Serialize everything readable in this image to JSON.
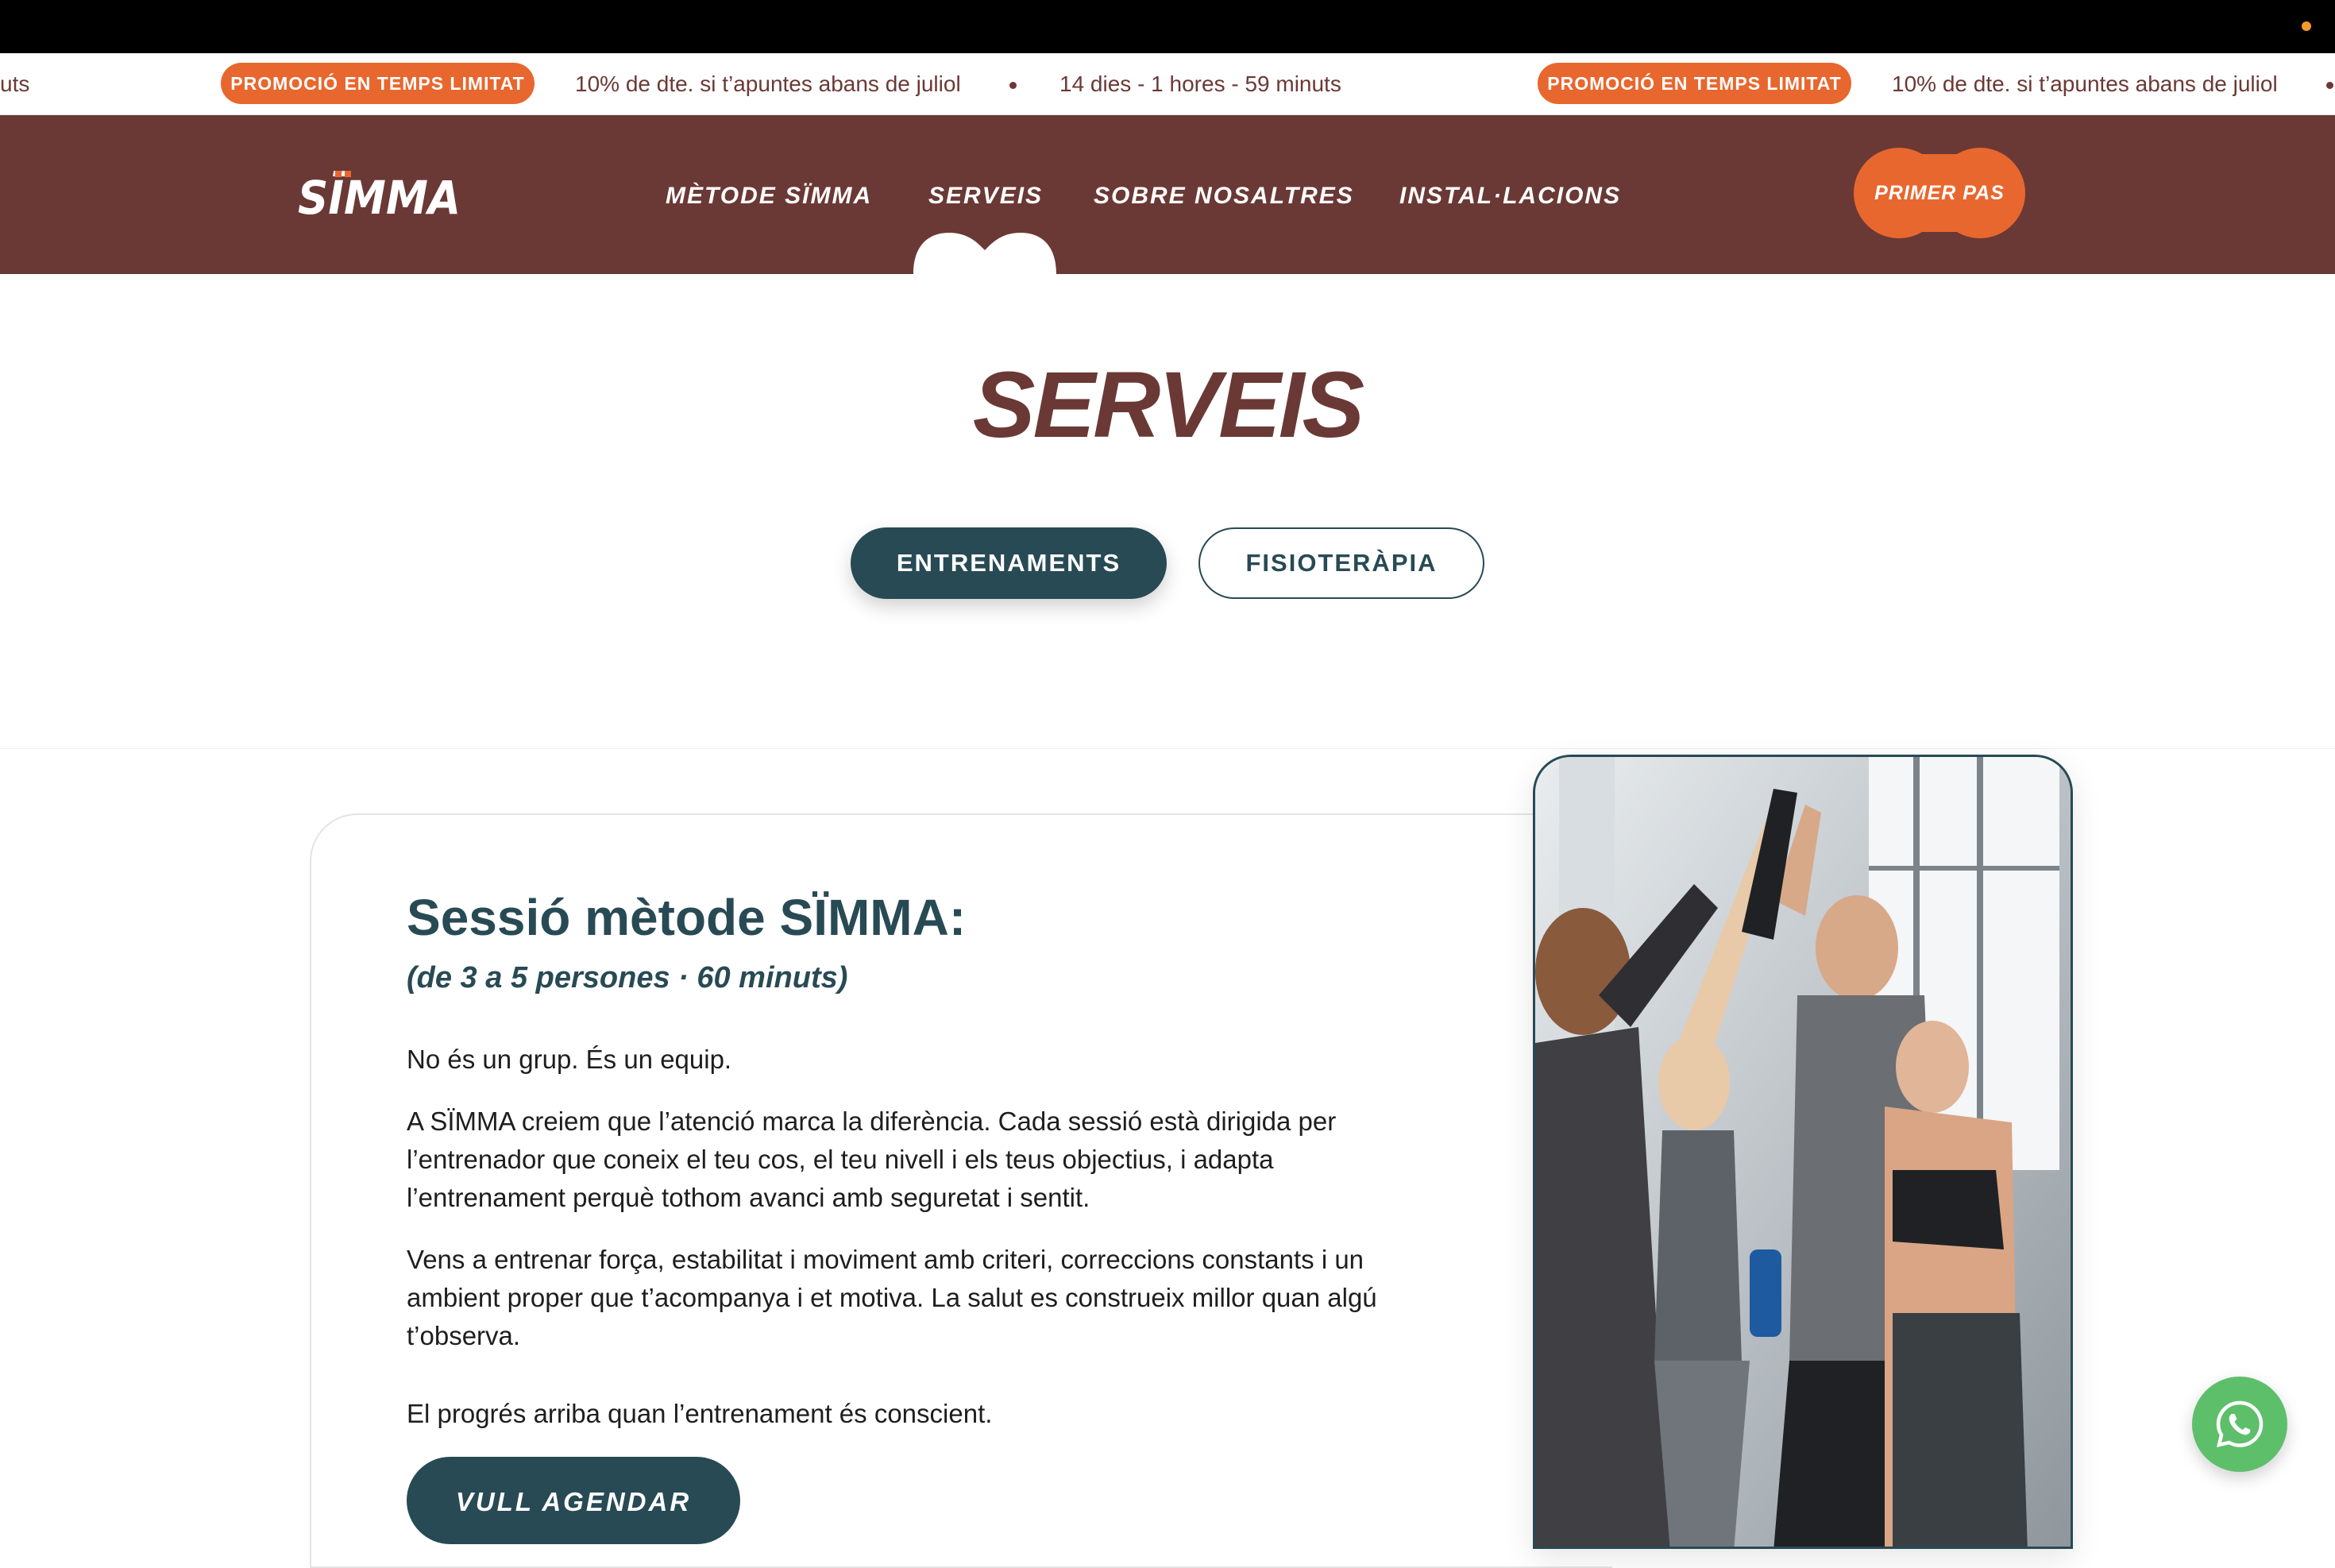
{
  "ticker": {
    "fragment_left": "uts",
    "badge": "PROMOCIÓ EN TEMPS LIMITAT",
    "offer": "10% de dte. si t’apuntes abans de juliol",
    "countdown": "14 dies - 1 hores - 59 minuts"
  },
  "header": {
    "logo_text": "SÏMMA",
    "nav": [
      "MÈTODE SÏMMA",
      "SERVEIS",
      "SOBRE NOSALTRES",
      "INSTAL·LACIONS"
    ],
    "active_nav": "SERVEIS",
    "cta_label": "PRIMER PAS",
    "colors": {
      "brand": "#6b3935",
      "accent": "#e8672e"
    }
  },
  "main": {
    "title": "SERVEIS",
    "tabs": [
      {
        "label": "ENTRENAMENTS",
        "active": true
      },
      {
        "label": "FISIOTERÀPIA",
        "active": false
      }
    ],
    "card": {
      "title": "Sessió mètode SÏMMA:",
      "subtitle": "(de 3 a 5 persones · 60 minuts)",
      "paragraphs": [
        "No és un grup. És un equip.",
        "A SÏMMA creiem que l’atenció marca la diferència. Cada sessió està dirigida per l’entrenador que coneix el teu cos, el teu nivell i els teus objectius, i adapta l’entrenament perquè tothom avanci amb seguretat i sentit.",
        "Vens a entrenar força, estabilitat i moviment amb criteri, correccions constants i un ambient proper que t’acompanya i et motiva. La salut es construeix millor quan algú t’observa.",
        "El progrés arriba quan l’entrenament és conscient."
      ],
      "button_label": "VULL AGENDAR",
      "colors": {
        "primary": "#284a54"
      }
    },
    "photo_icon": "group-high-five-photo"
  },
  "floating": {
    "whatsapp_icon": "whatsapp-icon",
    "color": "#5ebf6a"
  }
}
